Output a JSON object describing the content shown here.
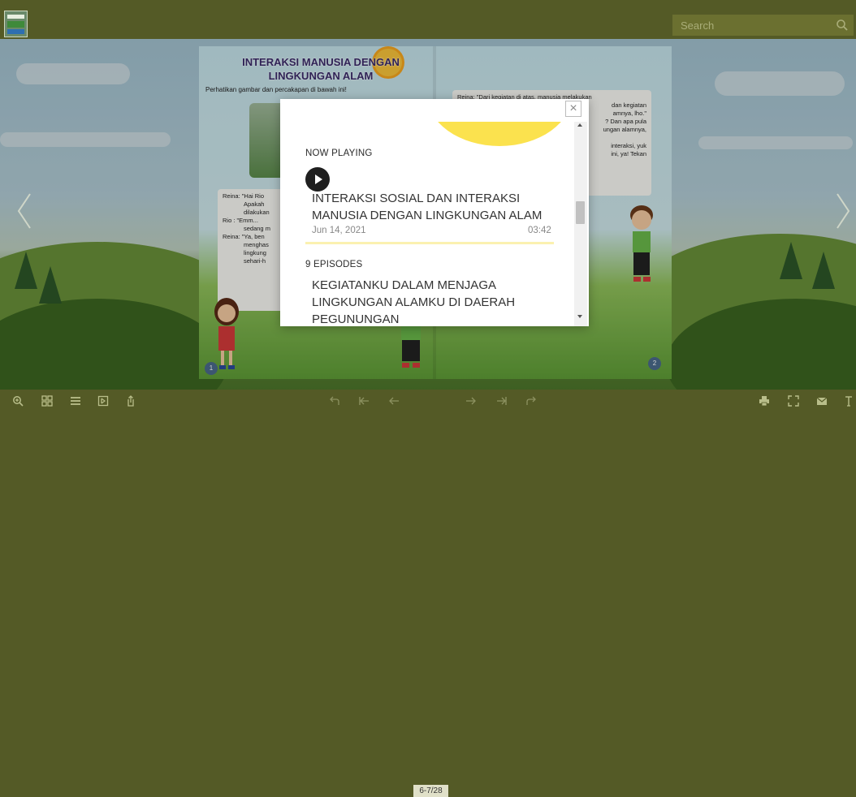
{
  "search": {
    "placeholder": "Search"
  },
  "book": {
    "page_title": "INTERAKSI MANUSIA DENGAN LINGKUNGAN ALAM",
    "instruction": "Perhatikan gambar dan percakapan di bawah ini!",
    "left_dialog": [
      "Reina: \"Hai Rio",
      "Apakah",
      "dilakukan",
      "Rio : \"Emm...",
      "sedang m",
      "Reina: \"Ya, ben",
      "menghas",
      "lingkung",
      "sehari-h"
    ],
    "right_dialog": [
      "Reina: \"Dari kegiatan di atas, manusia melakukan",
      "dan kegiatan",
      "amnya, lho.\"",
      "? Dan apa pula",
      "ungan alamnya,",
      "interaksi, yuk",
      "ini, ya! Tekan"
    ],
    "left_page_number": "1",
    "right_page_number": "2"
  },
  "player": {
    "close_glyph": "×",
    "now_playing_label": "NOW PLAYING",
    "now_playing": {
      "title": "INTERAKSI SOSIAL DAN INTERAKSI MANUSIA DENGAN LINGKUNGAN ALAM",
      "date": "Jun 14, 2021",
      "duration": "03:42"
    },
    "episodes_label": "9 EPISODES",
    "episodes": [
      {
        "title": "KEGIATANKU DALAM MENJAGA LINGKUNGAN ALAMKU DI DAERAH PEGUNUNGAN"
      }
    ]
  },
  "toolbar": {
    "page_indicator": "6-7/28",
    "left_tools": [
      "zoom-in-icon",
      "thumbnails-icon",
      "table-of-contents-icon",
      "bookmark-icon",
      "share-icon"
    ],
    "center_tools": [
      "undo-icon",
      "first-page-icon",
      "prev-page-icon",
      "next-page-icon",
      "last-page-icon",
      "redo-icon"
    ],
    "right_tools": [
      "print-icon",
      "fullscreen-icon",
      "email-icon",
      "text-icon"
    ]
  },
  "colors": {
    "toolbar": "#545a26",
    "accent_yellow": "#fbe24e",
    "play_button": "#1f1f1f"
  }
}
